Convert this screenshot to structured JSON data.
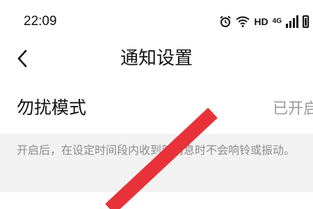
{
  "status_bar": {
    "time": "22:09",
    "network_label": "HD",
    "signal_label": "4G",
    "icons": [
      "alarm-icon",
      "wifi-icon",
      "cell-signal-icon",
      "battery-icon"
    ]
  },
  "nav": {
    "title": "通知设置",
    "back_icon": "back-chevron-icon"
  },
  "dnd": {
    "label": "勿扰模式",
    "value": "已开启"
  },
  "description": "开启后，在设定时间段内收到新消息时不会响铃或振动。",
  "colors": {
    "strike": "#e8323a",
    "muted_text": "#9a9a9a",
    "section_bg": "#f2f2f2"
  }
}
